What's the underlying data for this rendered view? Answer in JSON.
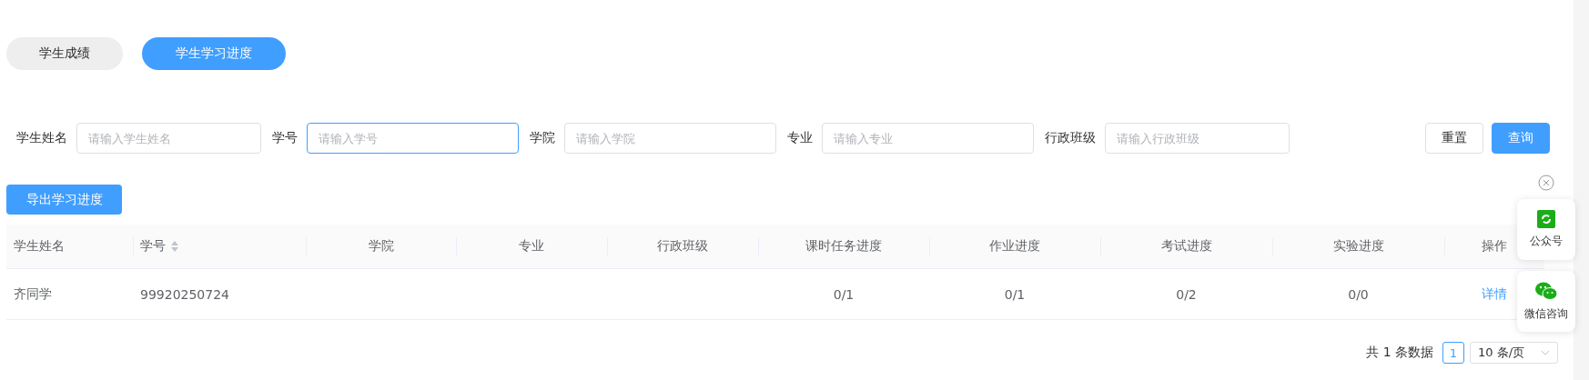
{
  "tabs": [
    {
      "label": "学生成绩",
      "selected": false
    },
    {
      "label": "学生学习进度",
      "selected": true
    }
  ],
  "filters": [
    {
      "label": "学生姓名",
      "placeholder": "请输入学生姓名",
      "focused": false
    },
    {
      "label": "学号",
      "placeholder": "请输入学号",
      "focused": true
    },
    {
      "label": "学院",
      "placeholder": "请输入学院",
      "focused": false
    },
    {
      "label": "专业",
      "placeholder": "请输入专业",
      "focused": false
    },
    {
      "label": "行政班级",
      "placeholder": "请输入行政班级",
      "focused": false
    }
  ],
  "filter_buttons": [
    {
      "label": "重置",
      "kind": "default"
    },
    {
      "label": "查询",
      "kind": "primary"
    }
  ],
  "export_button": "导出学习进度",
  "table": {
    "columns": [
      {
        "label": "学生姓名",
        "sortable": false
      },
      {
        "label": "学号",
        "sortable": true
      },
      {
        "label": "学院",
        "sortable": false
      },
      {
        "label": "专业",
        "sortable": false
      },
      {
        "label": "行政班级",
        "sortable": false
      },
      {
        "label": "课时任务进度",
        "sortable": false
      },
      {
        "label": "作业进度",
        "sortable": false
      },
      {
        "label": "考试进度",
        "sortable": false
      },
      {
        "label": "实验进度",
        "sortable": false
      },
      {
        "label": "操作",
        "sortable": false
      }
    ],
    "rows": [
      {
        "cells": [
          "齐同学",
          "99920250724",
          "",
          "",
          "",
          "0/1",
          "0/1",
          "0/2",
          "0/0"
        ],
        "action": "详情"
      }
    ]
  },
  "pagination": {
    "total": "共 1 条数据",
    "pages": [
      {
        "label": "1",
        "selected": true
      }
    ],
    "page_size": "10 条/页"
  },
  "float_widgets": [
    {
      "kind": "official",
      "label": "公众号"
    },
    {
      "kind": "wechat",
      "label": "微信咨询"
    }
  ]
}
